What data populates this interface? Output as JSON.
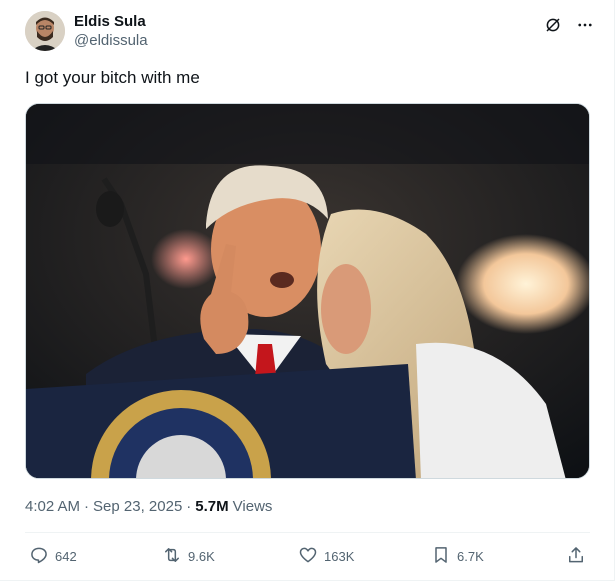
{
  "author": {
    "display_name": "Eldis Sula",
    "handle": "@eldissula"
  },
  "header_icons": [
    "grok-icon",
    "more-icon"
  ],
  "tweet": {
    "text": "I got your bitch with me"
  },
  "meta": {
    "time": "4:02 AM",
    "separator": "·",
    "date": "Sep 23, 2025",
    "views_count": "5.7M",
    "views_label": "Views"
  },
  "actions": {
    "replies": "642",
    "reposts": "9.6K",
    "likes": "163K",
    "bookmarks": "6.7K"
  },
  "colors": {
    "text_primary": "#0f1419",
    "text_secondary": "#536471",
    "border": "#eff3f4"
  }
}
